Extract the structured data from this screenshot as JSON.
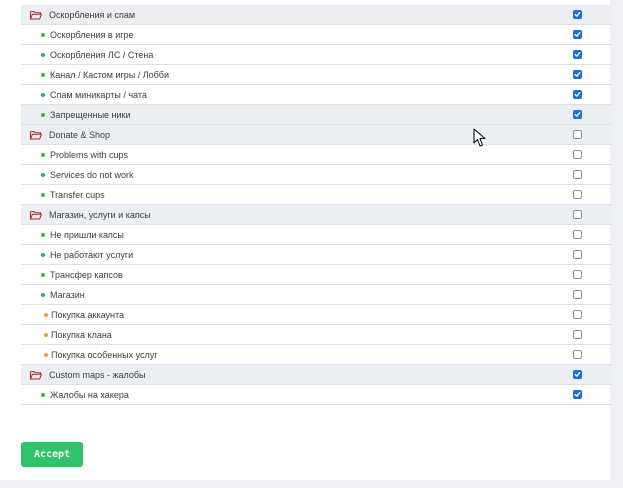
{
  "accent_color": "#1a73d9",
  "accept_color": "#2ec46a",
  "rows": [
    {
      "type": "group",
      "label": "Оскорбления и спам",
      "checked": true,
      "icon": "folder-open-icon"
    },
    {
      "type": "item",
      "label": "Оскорбления в игре",
      "checked": true,
      "bullet": "green"
    },
    {
      "type": "item",
      "label": "Оскорбления ЛС / Стена",
      "checked": true,
      "bullet": "green"
    },
    {
      "type": "item",
      "label": "Канал / Кастом игры / Лобби",
      "checked": true,
      "bullet": "green"
    },
    {
      "type": "item",
      "label": "Спам миникарты / чата",
      "checked": true,
      "bullet": "green"
    },
    {
      "type": "item",
      "label": "Запрещенные ники",
      "checked": true,
      "bullet": "green",
      "highlight": true
    },
    {
      "type": "group",
      "label": "Donate & Shop",
      "checked": false,
      "icon": "folder-open-icon"
    },
    {
      "type": "item",
      "label": "Problems with cups",
      "checked": false,
      "bullet": "green"
    },
    {
      "type": "item",
      "label": "Services do not work",
      "checked": false,
      "bullet": "green"
    },
    {
      "type": "item",
      "label": "Transfer cups",
      "checked": false,
      "bullet": "green"
    },
    {
      "type": "group",
      "label": "Магазин, услуги и капсы",
      "checked": false,
      "icon": "folder-open-icon"
    },
    {
      "type": "item",
      "label": "Не пришли капсы",
      "checked": false,
      "bullet": "green"
    },
    {
      "type": "item",
      "label": "Не работают услуги",
      "checked": false,
      "bullet": "green"
    },
    {
      "type": "item",
      "label": "Трансфер капсов",
      "checked": false,
      "bullet": "green"
    },
    {
      "type": "item",
      "label": "Магазин",
      "checked": false,
      "bullet": "green"
    },
    {
      "type": "item",
      "label": "Покупка аккаунта",
      "checked": false,
      "bullet": "orange"
    },
    {
      "type": "item",
      "label": "Покупка клана",
      "checked": false,
      "bullet": "orange"
    },
    {
      "type": "item",
      "label": "Покупка особенных услуг",
      "checked": false,
      "bullet": "orange"
    },
    {
      "type": "group",
      "label": "Custom maps - жалобы",
      "checked": true,
      "icon": "folder-open-icon"
    },
    {
      "type": "item",
      "label": "Жалобы на хакера",
      "checked": true,
      "bullet": "green"
    }
  ],
  "accept_label": "Accept"
}
